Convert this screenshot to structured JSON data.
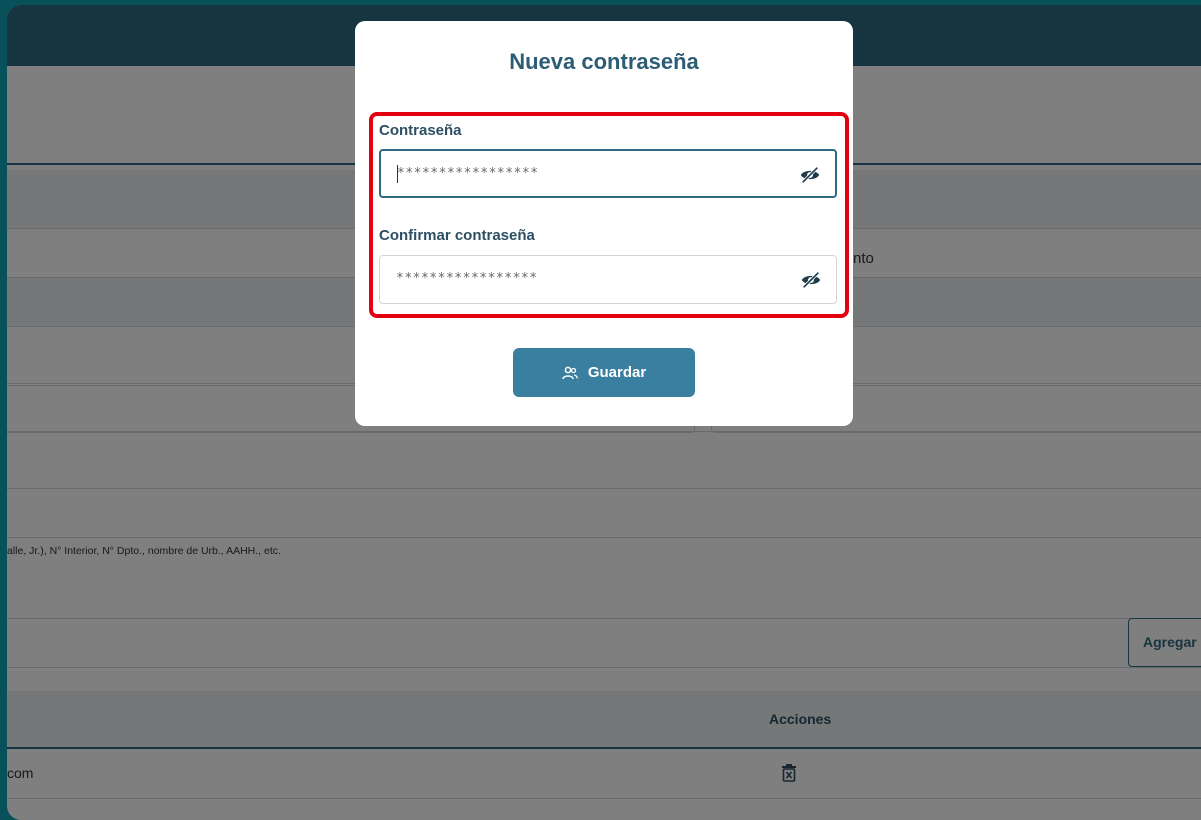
{
  "background": {
    "partial_label_right": "nto",
    "address_hint": "alle, Jr.), N° Interior, N° Dpto., nombre de Urb., AAHH., etc.",
    "add_button_label": "Agregar",
    "table_header_actions": "Acciones",
    "table_row_email_fragment": "com",
    "delete_icon": "trash-x-icon"
  },
  "modal": {
    "title": "Nueva contraseña",
    "password_label": "Contraseña",
    "password_value": "*****************",
    "confirm_label": "Confirmar contraseña",
    "confirm_value": "*****************",
    "visibility_icon": "eye-off-icon",
    "save_label": "Guardar",
    "save_icon": "users-icon"
  },
  "colors": {
    "primary": "#2f6b80",
    "button": "#3a7fa0",
    "highlight": "#e3000f",
    "frame_border": "#12a3b5"
  }
}
